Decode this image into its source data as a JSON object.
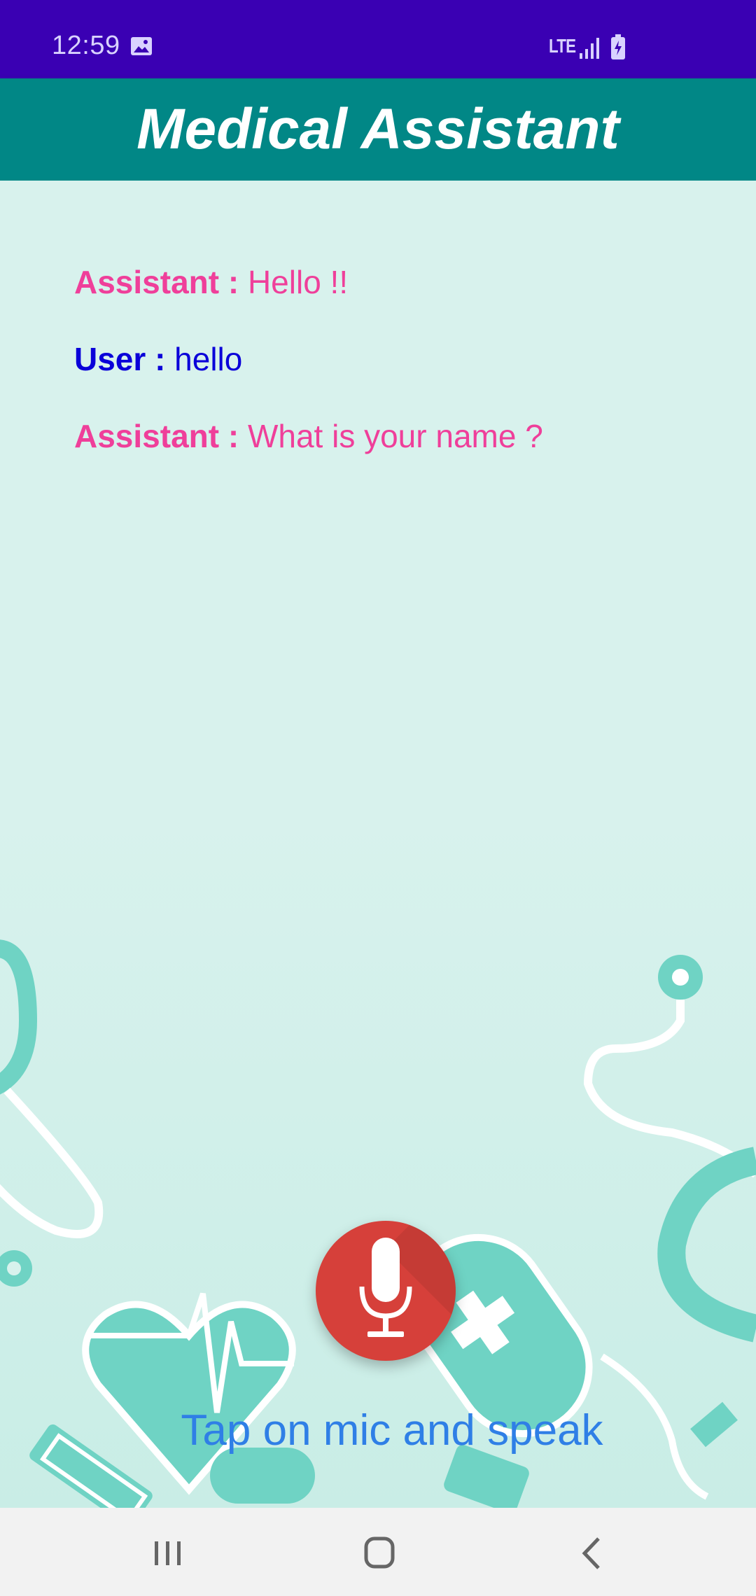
{
  "status_bar": {
    "time": "12:59",
    "network": "LTE",
    "icons": [
      "image-icon",
      "signal-icon",
      "battery-charging-icon"
    ]
  },
  "app_bar": {
    "title": "Medical Assistant",
    "color": "#018786"
  },
  "conversation": [
    {
      "speaker": "Assistant :",
      "text": " Hello !!",
      "role": "assistant"
    },
    {
      "speaker": "User :",
      "text": " hello",
      "role": "user"
    },
    {
      "speaker": "Assistant :",
      "text": " What is your name ?",
      "role": "assistant"
    }
  ],
  "mic": {
    "icon": "microphone-icon",
    "color": "#d6403a"
  },
  "hint": "Tap on mic and speak",
  "nav_bar": {
    "icons": [
      "recent-apps-icon",
      "home-icon",
      "back-icon"
    ]
  },
  "colors": {
    "status_bar": "#3a00b3",
    "assistant_text": "#ef3f9a",
    "user_text": "#0a00d9",
    "hint_text": "#2f7fe6",
    "decor": "#6fd3c4"
  }
}
